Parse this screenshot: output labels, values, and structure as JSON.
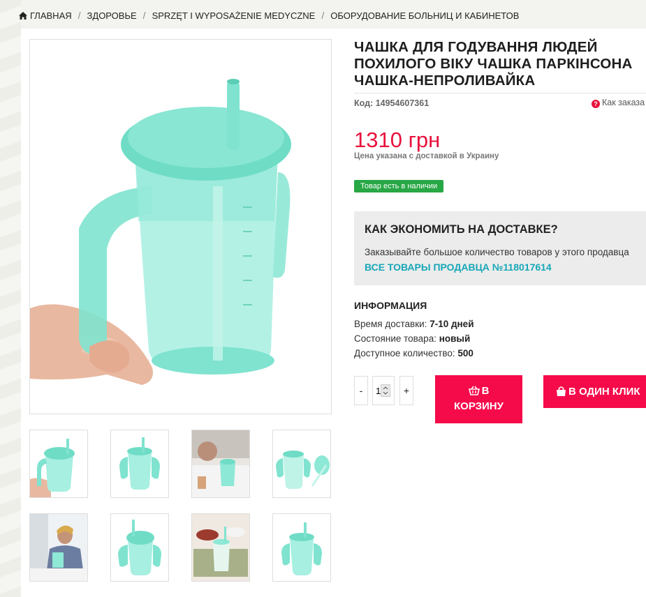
{
  "breadcrumb": {
    "items": [
      "ГЛАВНАЯ",
      "ЗДОРОВЬЕ",
      "SPRZĘT I WYPOSAŻENIE MEDYCZNE",
      "ОБОРУДОВАНИЕ БОЛЬНИЦ И КАБИНЕТОВ"
    ]
  },
  "product": {
    "title": "ЧАШКА ДЛЯ ГОДУВАННЯ ЛЮДЕЙ ПОХИЛОГО ВІКУ ЧАШКА ПАРКІНСОНА ЧАШКА-НЕПРОЛИВАЙКА",
    "code_label": "Код:",
    "code": "14954607361",
    "how_to_order": "Как заказа",
    "price": "1310 грн",
    "price_note": "Цена указана с доставкой в Украину",
    "stock": "Товар есть в наличии"
  },
  "delivery": {
    "title": "КАК ЭКОНОМИТЬ НА ДОСТАВКЕ?",
    "text": "Заказывайте большое количество товаров у этого продавца",
    "seller_link": "ВСЕ ТОВАРЫ ПРОДАВЦА №118017614"
  },
  "info": {
    "heading": "ИНФОРМАЦИЯ",
    "rows": [
      {
        "label": "Время доставки:",
        "value": "7-10 дней"
      },
      {
        "label": "Состояние товара:",
        "value": "новый"
      },
      {
        "label": "Доступное количество:",
        "value": "500"
      }
    ]
  },
  "purchase": {
    "minus": "-",
    "plus": "+",
    "quantity": "1",
    "cart_line1": "В",
    "cart_line2": "КОРЗИНУ",
    "one_click": "В ОДИН КЛИК"
  },
  "colors": {
    "accent": "#f50a4a",
    "price": "#e8113c",
    "stock": "#28a745",
    "link": "#17a7b8",
    "cup": "#7fe3cf"
  },
  "gallery": {
    "thumb_count": 8
  }
}
